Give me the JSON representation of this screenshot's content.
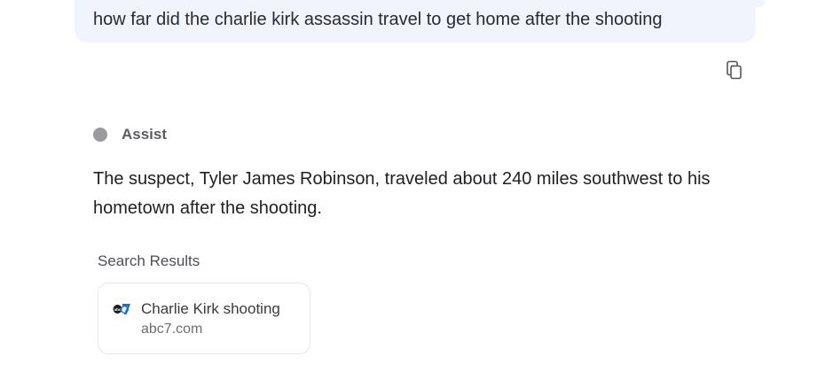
{
  "query": {
    "text": "how far did the charlie kirk assassin travel to get home after the shooting"
  },
  "toolbar": {
    "copy_icon": "copy-icon"
  },
  "assistant": {
    "label": "Assist",
    "answer": "The suspect, Tyler James Robinson, traveled about 240 miles southwest to his hometown after the shooting."
  },
  "search_results": {
    "title": "Search Results",
    "items": [
      {
        "title": "Charlie Kirk shooting",
        "domain": "abc7.com",
        "icon": "abc7-logo-icon"
      }
    ]
  },
  "colors": {
    "query_bubble_bg": "#f1f3fd",
    "abc_blue": "#1c6fd1",
    "abc_dark": "#1a1a1a"
  }
}
